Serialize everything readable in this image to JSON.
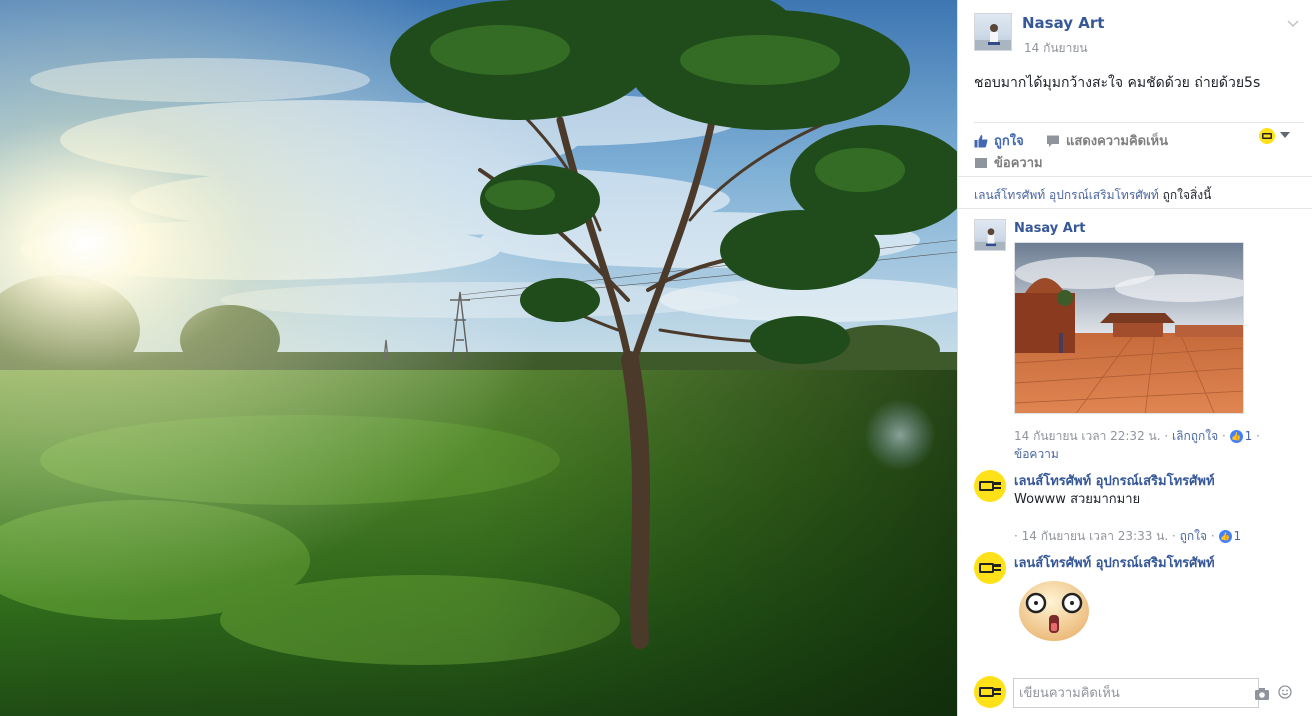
{
  "post": {
    "author": "Nasay Art",
    "date": "14 กันยายน",
    "text": "ชอบมากได้มุมกว้างสะใจ คมชัดด้วย ถ่ายด้วย5s"
  },
  "actions": {
    "like": "ถูกใจ",
    "comment": "แสดงความคิดเห็น",
    "message": "ข้อความ"
  },
  "likes_line": {
    "page": "เลนส์โทรศัพท์ อุปกรณ์เสริมโทรศัพท์",
    "suffix": "ถูกใจสิ่งนี้"
  },
  "comments": [
    {
      "author": "Nasay Art",
      "meta_time": "14 กันยายน เวลา 22:32 น.",
      "unlike": "เลิกถูกใจ",
      "like_count": "1",
      "message": "ข้อความ"
    },
    {
      "author": "เลนส์โทรศัพท์ อุปกรณ์เสริมโทรศัพท์",
      "text": "Wowww สวยมากมาย",
      "meta_time": "14 กันยายน เวลา 23:33 น.",
      "like": "ถูกใจ",
      "like_count": "1"
    },
    {
      "author": "เลนส์โทรศัพท์ อุปกรณ์เสริมโทรศัพท์"
    }
  ],
  "composer": {
    "placeholder": "เขียนความคิดเห็น"
  },
  "colors": {
    "name": "#365899",
    "accent": "#4267b2",
    "meta": "#90949c",
    "badge": "#ffe11a"
  },
  "icons": [
    "chevron-down-icon",
    "thumbs-up-icon",
    "comment-icon",
    "messenger-icon",
    "like-badge-icon",
    "camera-icon",
    "smiley-icon",
    "shocked-emoji-sticker"
  ]
}
